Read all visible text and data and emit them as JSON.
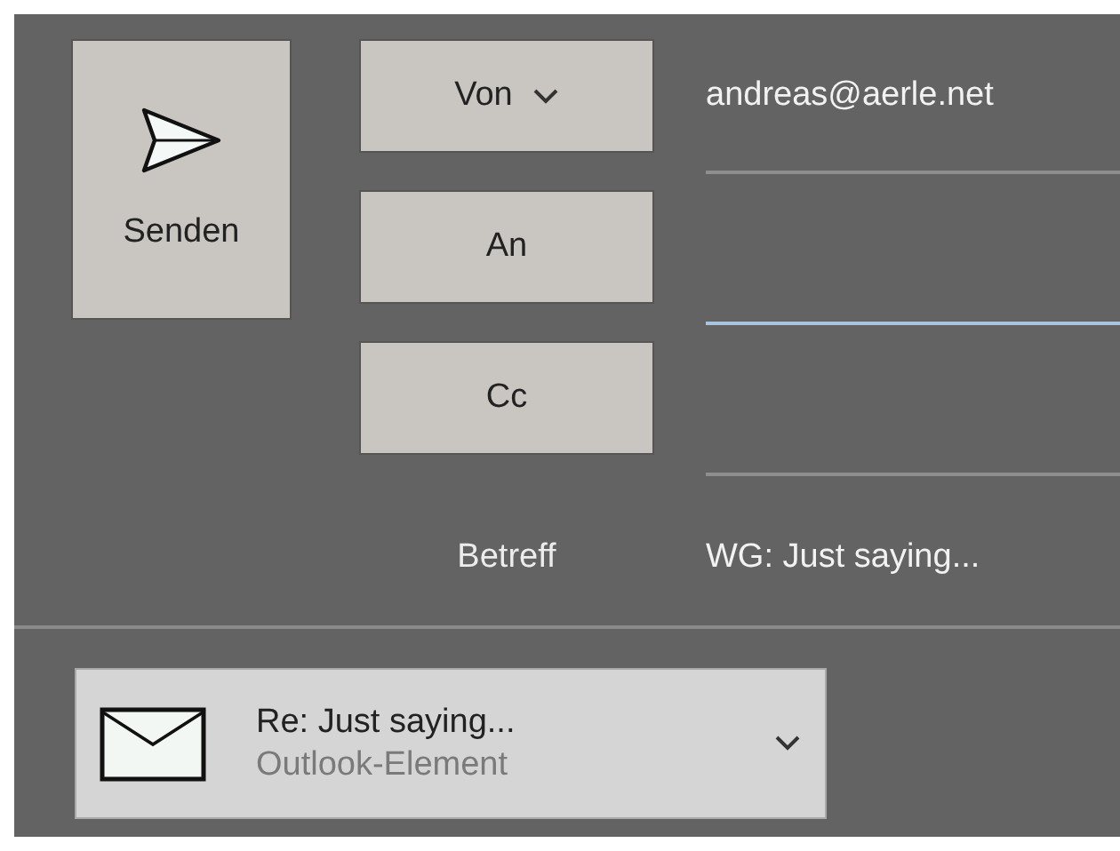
{
  "send_button": {
    "label": "Senden"
  },
  "fields": [
    {
      "label": "Von",
      "kind": "dropdown",
      "value": "andreas@aerle.net",
      "focused": false
    },
    {
      "label": "An",
      "kind": "button",
      "focused": true
    },
    {
      "label": "Cc",
      "kind": "button",
      "focused": false
    }
  ],
  "subject": {
    "label": "Betreff",
    "value": "WG: Just saying..."
  },
  "attachment": {
    "name": "Re: Just saying...",
    "type": "Outlook-Element"
  }
}
